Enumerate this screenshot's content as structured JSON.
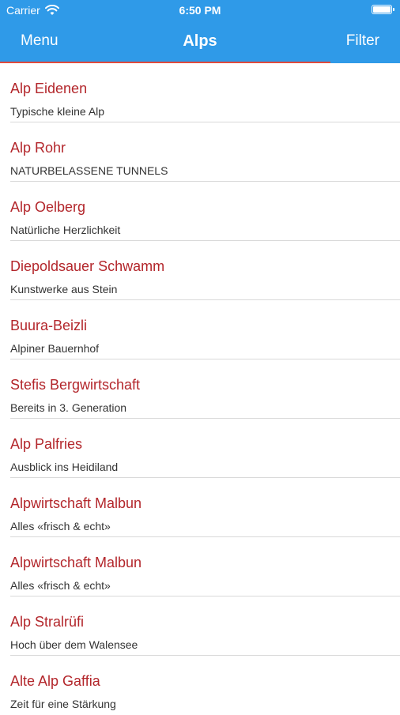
{
  "status_bar": {
    "carrier": "Carrier",
    "time": "6:50 PM",
    "wifi_icon": "wifi-icon",
    "battery_icon": "battery-icon"
  },
  "nav": {
    "left_label": "Menu",
    "title": "Alps",
    "right_label": "Filter"
  },
  "colors": {
    "bar_blue": "#2f9ae8",
    "title_red": "#b3262b",
    "indicator_red": "#e04a3c"
  },
  "alps": [
    {
      "name": "Alp Eidenen",
      "subtitle": "Typische kleine Alp"
    },
    {
      "name": "Alp Rohr",
      "subtitle": "NATURBELASSENE TUNNELS"
    },
    {
      "name": "Alp Oelberg",
      "subtitle": "Natürliche Herzlichkeit"
    },
    {
      "name": "Diepoldsauer Schwamm",
      "subtitle": "Kunstwerke aus Stein"
    },
    {
      "name": "Buura-Beizli",
      "subtitle": "Alpiner Bauernhof"
    },
    {
      "name": "Stefis Bergwirtschaft",
      "subtitle": "Bereits in 3. Generation"
    },
    {
      "name": "Alp Palfries",
      "subtitle": "Ausblick ins Heidiland"
    },
    {
      "name": "Alpwirtschaft Malbun",
      "subtitle": "Alles «frisch & echt»"
    },
    {
      "name": "Alpwirtschaft Malbun",
      "subtitle": "Alles «frisch & echt»"
    },
    {
      "name": "Alp Stralrüfi",
      "subtitle": "Hoch über dem Walensee"
    },
    {
      "name": "Alte Alp Gaffia",
      "subtitle": "Zeit für eine Stärkung"
    }
  ]
}
